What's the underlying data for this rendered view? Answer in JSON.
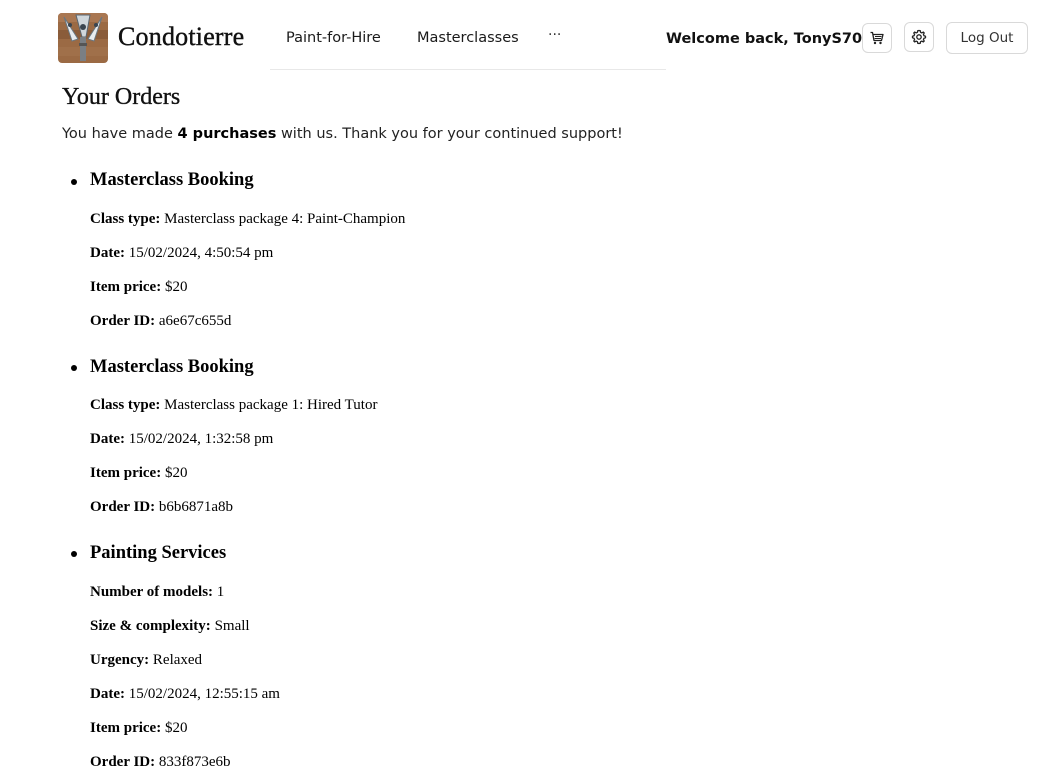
{
  "brand": {
    "name": "Condotierre"
  },
  "nav": {
    "items": [
      "Paint-for-Hire",
      "Masterclasses"
    ],
    "more": "···"
  },
  "user": {
    "welcome": "Welcome back, TonyS70"
  },
  "actions": {
    "cart_icon": "cart-icon",
    "settings_icon": "gear-icon",
    "logout": "Log Out"
  },
  "page": {
    "title": "Your Orders",
    "intro_prefix": "You have made ",
    "intro_count": "4 purchases",
    "intro_suffix": " with us. Thank you for your continued support!"
  },
  "orders": [
    {
      "title": "Masterclass Booking",
      "fields": [
        {
          "label": "Class type:",
          "value": "Masterclass package 4: Paint-Champion"
        },
        {
          "label": "Date:",
          "value": "15/02/2024, 4:50:54 pm"
        },
        {
          "label": "Item price:",
          "value": "$20"
        },
        {
          "label": "Order ID:",
          "value": "a6e67c655d"
        }
      ]
    },
    {
      "title": "Masterclass Booking",
      "fields": [
        {
          "label": "Class type:",
          "value": "Masterclass package 1: Hired Tutor"
        },
        {
          "label": "Date:",
          "value": "15/02/2024, 1:32:58 pm"
        },
        {
          "label": "Item price:",
          "value": "$20"
        },
        {
          "label": "Order ID:",
          "value": "b6b6871a8b"
        }
      ]
    },
    {
      "title": "Painting Services",
      "fields": [
        {
          "label": "Number of models:",
          "value": "1"
        },
        {
          "label": "Size & complexity:",
          "value": "Small"
        },
        {
          "label": "Urgency:",
          "value": "Relaxed"
        },
        {
          "label": "Date:",
          "value": "15/02/2024, 12:55:15 am"
        },
        {
          "label": "Item price:",
          "value": "$20"
        },
        {
          "label": "Order ID:",
          "value": "833f873e6b"
        }
      ]
    }
  ]
}
